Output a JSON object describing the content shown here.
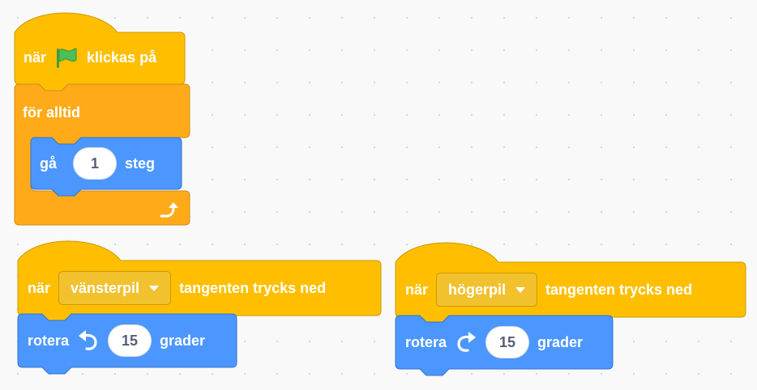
{
  "script1": {
    "hat": {
      "when": "när",
      "clicked": "klickas på"
    },
    "forever": {
      "label": "för alltid"
    },
    "move": {
      "label": "gå",
      "value": "1",
      "unit": "steg"
    }
  },
  "script2": {
    "hat": {
      "when": "när",
      "key": "vänsterpil",
      "suffix": "tangenten trycks ned"
    },
    "turn": {
      "label": "rotera",
      "value": "15",
      "unit": "grader"
    }
  },
  "script3": {
    "hat": {
      "when": "när",
      "key": "högerpil",
      "suffix": "tangenten trycks ned"
    },
    "turn": {
      "label": "rotera",
      "value": "15",
      "unit": "grader"
    }
  },
  "colors": {
    "events": "#ffbf00",
    "events_border": "#cc9900",
    "control": "#ffab19",
    "control_border": "#cf8b17",
    "motion": "#4c97ff",
    "motion_border": "#3373cc",
    "flag_green": "#4cbf56",
    "canvas_bg": "#f9f9f9"
  }
}
